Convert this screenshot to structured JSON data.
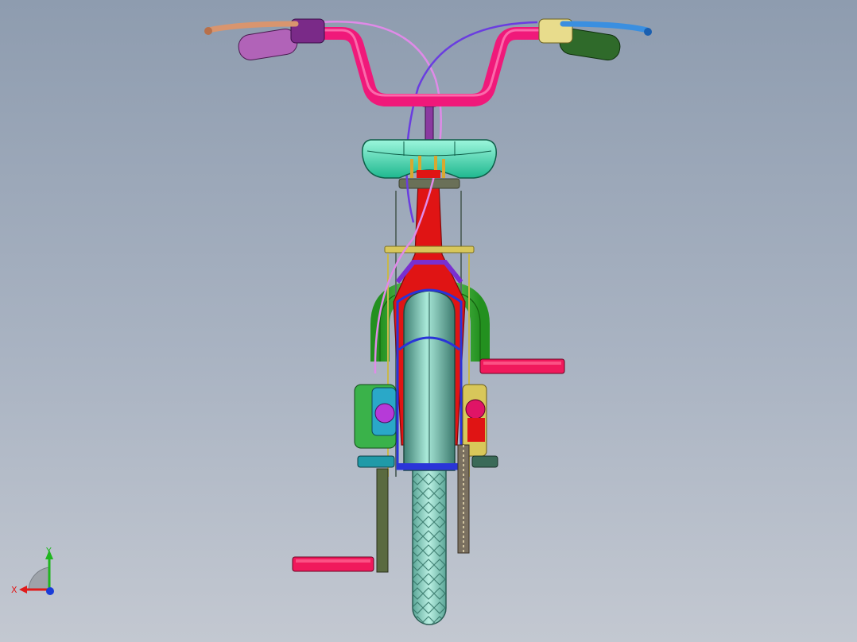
{
  "viewport": {
    "background_top": "#8e9caf",
    "background_bottom": "#c3c8d1"
  },
  "colors": {
    "handlebar": "#f0197a",
    "left_grip": "#b163b8",
    "right_grip": "#2f6a2a",
    "left_lever": "#d9956e",
    "right_lever": "#3a8fe0",
    "saddle": "#33e0b4",
    "frame": "#e01414",
    "fender_tire": "#72cdb8",
    "rear_frame": "#36c83a",
    "pedal": "#f0195c",
    "brake_cable_left": "#e08ae8",
    "brake_cable_right": "#6a3de0",
    "rack": "#c8b84a",
    "fork_clamp": "#2a34d8"
  },
  "axis_triad": {
    "y_label": "Y",
    "x_label": "X",
    "y_color": "#1fb51f",
    "x_color": "#e01b1b",
    "z_color": "#1a3cd8"
  }
}
